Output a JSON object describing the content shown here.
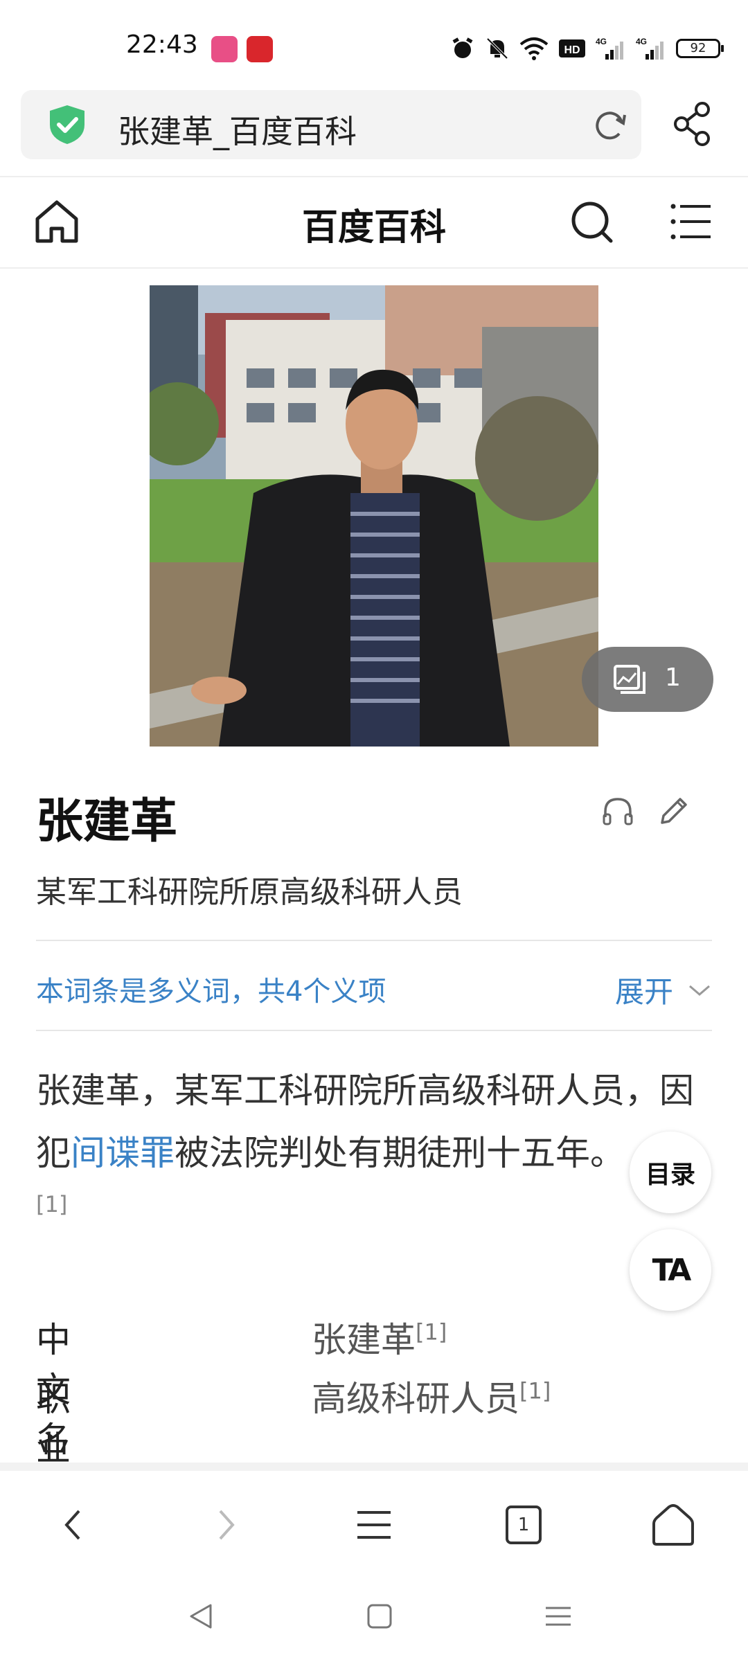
{
  "status_bar": {
    "time": "22:43",
    "battery": "92",
    "icons": [
      "alarm-icon",
      "mute-icon",
      "wifi-icon",
      "hd-icon",
      "signal-4g-icon",
      "signal-4g-icon"
    ]
  },
  "address_bar": {
    "title": "张建革_百度百科"
  },
  "site_header": {
    "title": "百度百科"
  },
  "gallery": {
    "count": "1"
  },
  "entry": {
    "title": "张建革",
    "subtitle": "某军工科研院所原高级科研人员",
    "polysemy": "本词条是多义词，共4个义项",
    "expand_label": "展开",
    "summary_part1": "张建革，某军工科研院所高级科研人员，因犯",
    "summary_link": "间谍罪",
    "summary_part2": "被法院判处有期徒刑十五年。",
    "summary_ref": "[1]"
  },
  "floating": {
    "toc_label": "目录",
    "ta_label": "TA"
  },
  "infobox": [
    {
      "key": "中文名",
      "value": "张建革",
      "ref": "[1]"
    },
    {
      "key": "职业",
      "value": "高级科研人员",
      "ref": "[1]"
    }
  ],
  "toolbar": {
    "tab_count": "1"
  },
  "colors": {
    "link": "#3a82c6",
    "shield": "#43c078"
  }
}
